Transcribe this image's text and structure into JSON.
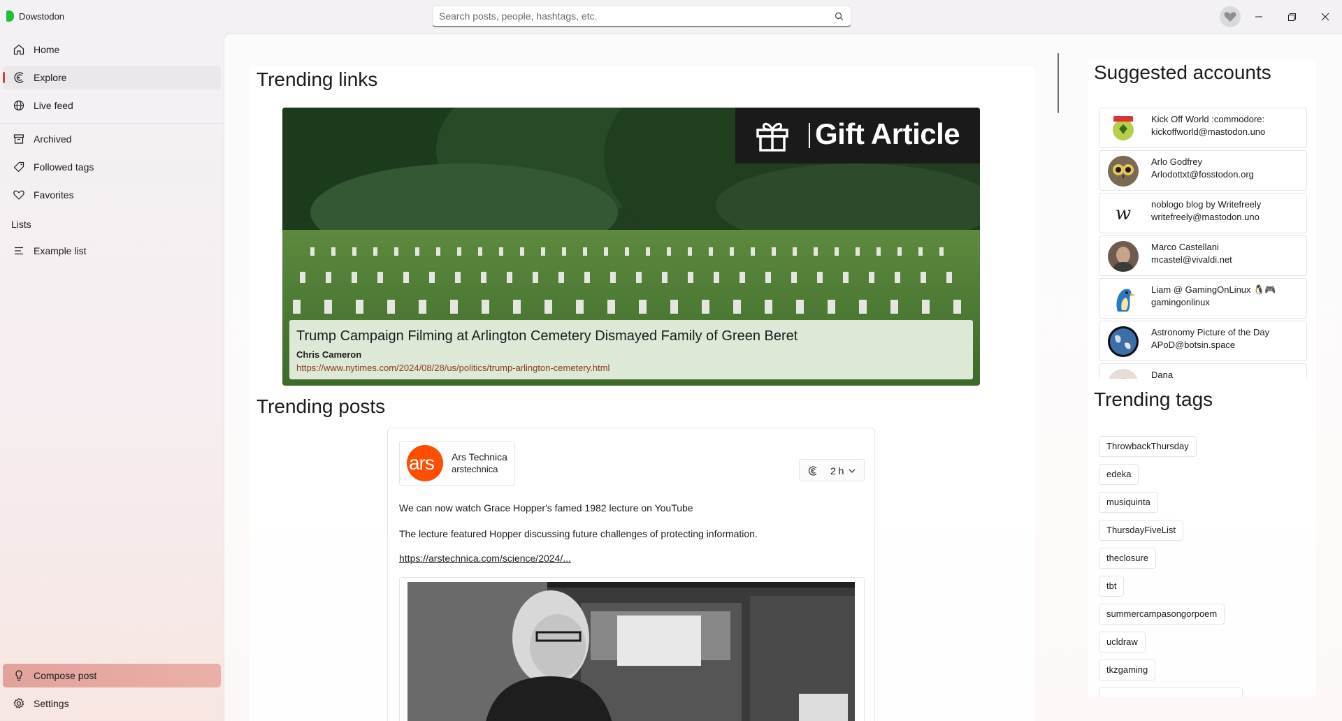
{
  "app": {
    "title": "Dowstodon"
  },
  "search": {
    "placeholder": "Search posts, people, hashtags, etc."
  },
  "window_controls": {
    "minimize": "minimize-icon",
    "maximize": "restore-icon",
    "close": "close-icon"
  },
  "sidebar": {
    "items": [
      {
        "label": "Home",
        "icon": "home-icon"
      },
      {
        "label": "Explore",
        "icon": "explore-icon",
        "selected": true
      },
      {
        "label": "Live feed",
        "icon": "globe-icon"
      },
      {
        "label": "Archived",
        "icon": "archive-icon"
      },
      {
        "label": "Followed tags",
        "icon": "tag-icon"
      },
      {
        "label": "Favorites",
        "icon": "heart-icon"
      }
    ],
    "lists_header": "Lists",
    "lists": [
      {
        "label": "Example list",
        "icon": "list-icon"
      }
    ],
    "compose": {
      "label": "Compose post",
      "icon": "compose-icon"
    },
    "settings": {
      "label": "Settings",
      "icon": "gear-icon"
    }
  },
  "trending_links": {
    "title": "Trending links",
    "card": {
      "banner_text": "Gift Article",
      "headline": "Trump Campaign Filming at Arlington Cemetery Dismayed Family of Green Beret",
      "author": "Chris Cameron",
      "url": "https://www.nytimes.com/2024/08/28/us/politics/trump-arlington-cemetery.html"
    }
  },
  "trending_posts": {
    "title": "Trending posts",
    "post": {
      "author_name": "Ars Technica",
      "author_handle": "arstechnica",
      "avatar_text": "ars",
      "time": "2 h",
      "paragraphs": [
        "We can now watch Grace Hopper's famed 1982 lecture on YouTube",
        "The lecture featured Hopper discussing future challenges of protecting information."
      ],
      "link": "https://arstechnica.com/science/2024/..."
    }
  },
  "suggested_accounts": {
    "title": "Suggested accounts",
    "items": [
      {
        "name": "Kick Off World :commodore:",
        "handle": "kickoffworld@mastodon.uno"
      },
      {
        "name": "Arlo Godfrey",
        "handle": "Arlodottxt@fosstodon.org"
      },
      {
        "name": "noblogo blog by Writefreely",
        "handle": "writefreely@mastodon.uno"
      },
      {
        "name": "Marco Castellani",
        "handle": "mcastel@vivaldi.net"
      },
      {
        "name": "Liam @ GamingOnLinux 🐧🎮",
        "handle": "gamingonlinux"
      },
      {
        "name": "Astronomy Picture of the Day",
        "handle": "APoD@botsin.space"
      },
      {
        "name": "Dana",
        "handle": ""
      }
    ]
  },
  "trending_tags": {
    "title": "Trending tags",
    "items": [
      "ThrowbackThursday",
      "edeka",
      "musiquinta",
      "ThursdayFiveList",
      "theclosure",
      "tbt",
      "summercampasongorpoem",
      "ucldraw",
      "tkzgaming"
    ]
  }
}
